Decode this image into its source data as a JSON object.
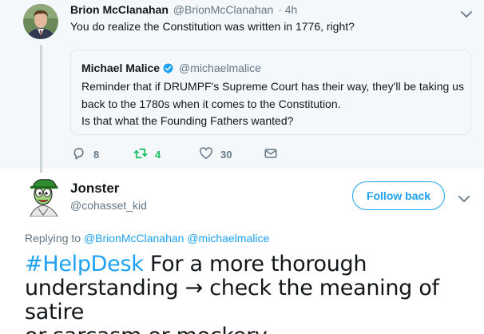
{
  "parent": {
    "name": "Brion McClanahan",
    "handle": "@BrionMcClanahan",
    "time": "· 4h",
    "text": "You do realize the Constitution was written in 1776, right?"
  },
  "quote": {
    "name": "Michael Malice",
    "handle": "@michaelmalice",
    "lines": [
      "Reminder that if DRUMPF's Supreme Court has their way, they'll be taking us",
      "back to the 1780s when it comes to the Constitution.",
      "Is that what the Founding Fathers wanted?"
    ]
  },
  "actions": {
    "replies": "8",
    "retweets": "4",
    "likes": "30"
  },
  "reply": {
    "name": "Jonster",
    "handle": "@cohasset_kid",
    "follow_label": "Follow back",
    "replying_prefix": "Replying to",
    "replying_to": [
      "@BrionMcClanahan",
      "@michaelmalice"
    ],
    "hashtag": "#HelpDesk",
    "text_line1": " For a more thorough",
    "text_line2": "understanding → check the meaning of satire",
    "text_line3": "or sarcasm or mockery"
  },
  "icons": {
    "reply": "reply-icon",
    "retweet": "retweet-icon",
    "like": "heart-icon",
    "dm": "envelope-icon",
    "menu": "chevron-down-icon",
    "verified": "verified-badge-icon"
  },
  "colors": {
    "accent": "#1da1f2",
    "retweet_green": "#17bf63",
    "secondary_text": "#657786",
    "parent_bg": "#f5f8fa"
  }
}
